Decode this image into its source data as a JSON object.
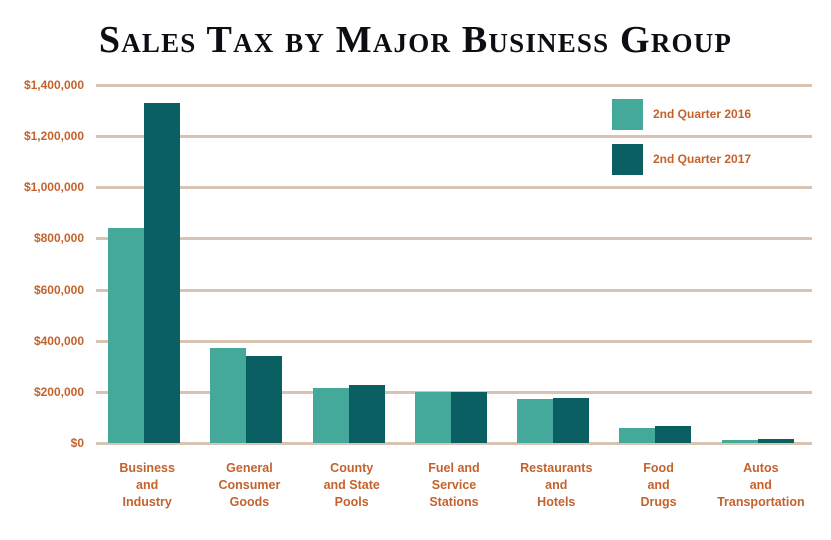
{
  "chart_data": {
    "type": "bar",
    "title": "Sales Tax by Major Business Group",
    "xlabel": "",
    "ylabel": "",
    "ylim": [
      0,
      1400000
    ],
    "ytick_values": [
      0,
      200000,
      400000,
      600000,
      800000,
      1000000,
      1200000,
      1400000
    ],
    "ytick_labels": [
      "$0",
      "$200,000",
      "$400,000",
      "$600,000",
      "$800,000",
      "$1,000,000",
      "$1,200,000",
      "$1,400,000"
    ],
    "grid": true,
    "legend_position": "upper right",
    "categories": [
      "Business and Industry",
      "General Consumer Goods",
      "County and State Pools",
      "Fuel and Service Stations",
      "Restaurants and Hotels",
      "Food and Drugs",
      "Autos and Transportation"
    ],
    "category_lines": [
      [
        "Business",
        "and",
        "Industry"
      ],
      [
        "General",
        "Consumer",
        "Goods"
      ],
      [
        "County",
        "and State",
        "Pools"
      ],
      [
        "Fuel and",
        "Service",
        "Stations"
      ],
      [
        "Restaurants",
        "and",
        "Hotels"
      ],
      [
        "Food",
        "and",
        "Drugs"
      ],
      [
        "Autos",
        "and",
        "Transportation"
      ]
    ],
    "series": [
      {
        "name": "2nd Quarter 2016",
        "color": "#44a89a",
        "values": [
          840000,
          372000,
          214000,
          198000,
          171000,
          58000,
          13000
        ]
      },
      {
        "name": "2nd Quarter 2017",
        "color": "#0a5f63",
        "values": [
          1330000,
          342000,
          226000,
          200000,
          176000,
          67000,
          14000
        ]
      }
    ]
  },
  "colors": {
    "gridline": "#d9c3b3",
    "axis_label": "#c4622d",
    "title": "#0d0d14",
    "background": "#ffffff"
  }
}
